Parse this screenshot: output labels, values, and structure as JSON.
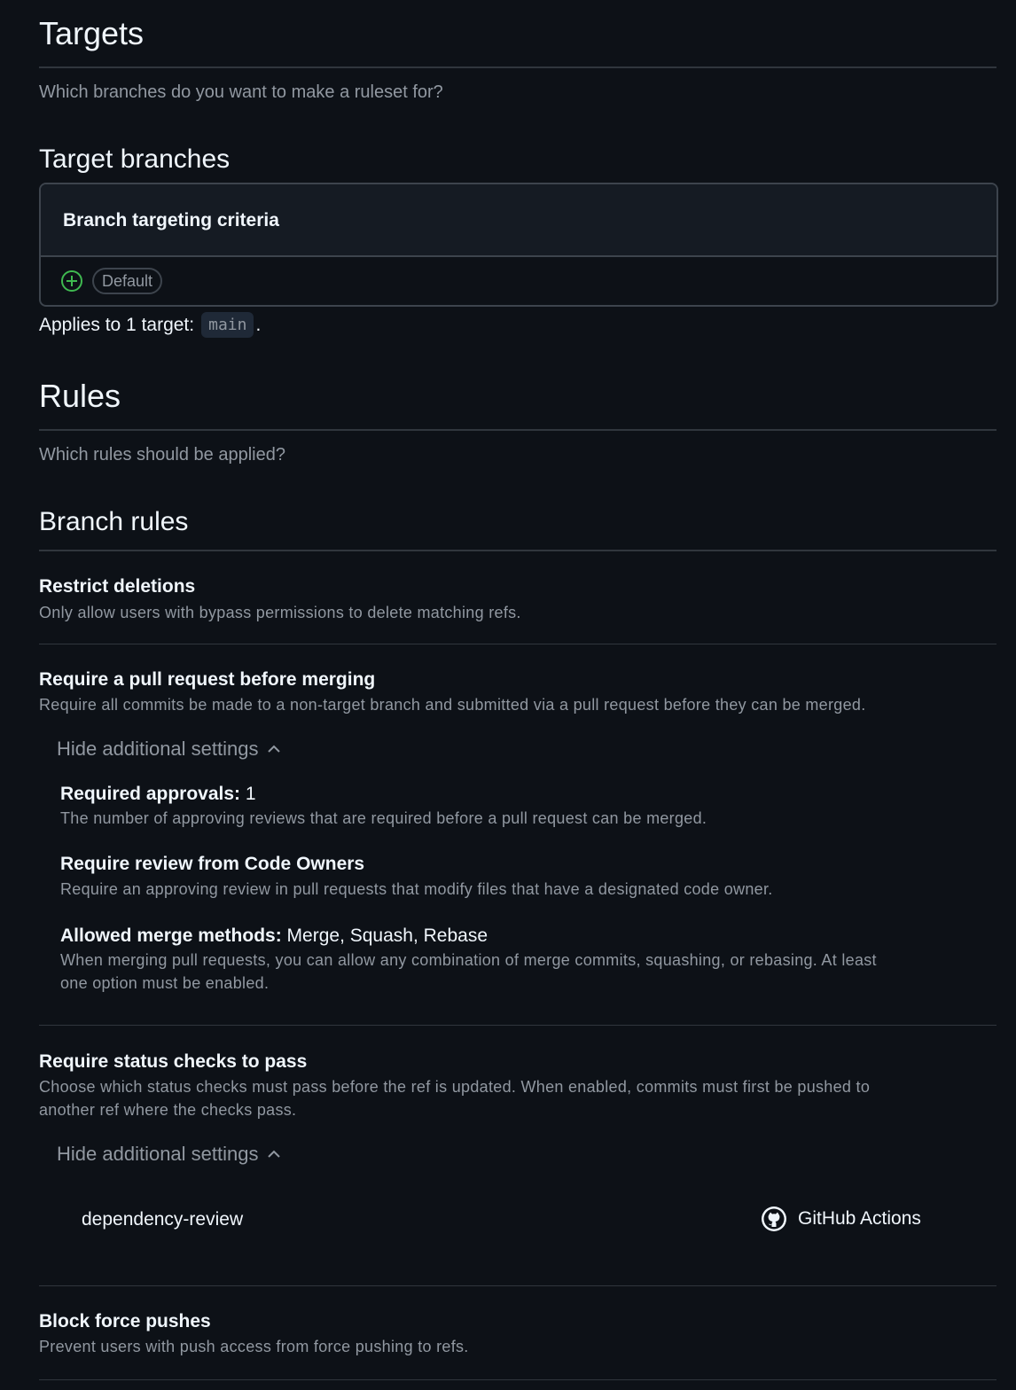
{
  "targets": {
    "title": "Targets",
    "subtitle": "Which branches do you want to make a ruleset for?",
    "branches_heading": "Target branches",
    "criteria_heading": "Branch targeting criteria",
    "default_chip": "Default",
    "applies_prefix": "Applies to 1 target:",
    "applies_target": "main",
    "applies_suffix": "."
  },
  "rules": {
    "title": "Rules",
    "subtitle": "Which rules should be applied?",
    "branch_rules_heading": "Branch rules"
  },
  "restrict_deletions": {
    "title": "Restrict deletions",
    "desc": "Only allow users with bypass permissions to delete matching refs."
  },
  "require_pr": {
    "title": "Require a pull request before merging",
    "desc": "Require all commits be made to a non-target branch and submitted via a pull request before they can be merged.",
    "toggle_label": "Hide additional settings",
    "approvals_label": "Required approvals:",
    "approvals_value": "1",
    "approvals_desc": "The number of approving reviews that are required before a pull request can be merged.",
    "code_owners_title": "Require review from Code Owners",
    "code_owners_desc": "Require an approving review in pull requests that modify files that have a designated code owner.",
    "merge_methods_label": "Allowed merge methods:",
    "merge_methods_value": "Merge, Squash, Rebase",
    "merge_methods_desc_1": "When merging pull requests, you can allow any combination of merge commits, squashing, or rebasing. At least",
    "merge_methods_desc_2": "one option must be enabled."
  },
  "status_checks": {
    "title": "Require status checks to pass",
    "desc_1": "Choose which status checks must pass before the ref is updated. When enabled, commits must first be pushed to",
    "desc_2": "another ref where the checks pass.",
    "toggle_label": "Hide additional settings",
    "check_name": "dependency-review",
    "check_source": "GitHub Actions"
  },
  "block_force_pushes": {
    "title": "Block force pushes",
    "desc": "Prevent users with push access from force pushing to refs."
  }
}
